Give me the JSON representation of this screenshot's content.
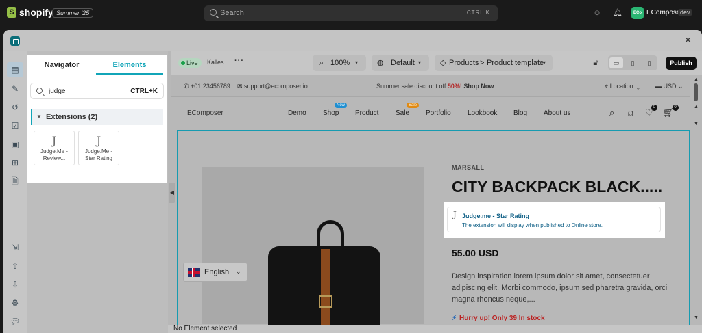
{
  "shopify": {
    "logo": "shopify",
    "edition": "Summer '25",
    "search_placeholder": "Search",
    "search_shortcut": "CTRL  K",
    "store_initials": "ECo",
    "store_name": "EComposer",
    "store_tag": "dev"
  },
  "panel": {
    "tabs": [
      "Navigator",
      "Elements"
    ],
    "active_tab": "Elements",
    "search_value": "judge",
    "search_shortcut": "CTRL+K",
    "group_label": "Extensions (2)",
    "cards": [
      {
        "glyph": "J",
        "name": "Judge.Me - Review..."
      },
      {
        "glyph": "J",
        "name": "Judge.Me - Star Rating"
      }
    ]
  },
  "toolbar": {
    "live_label": "Live",
    "theme_name": "Kalles",
    "zoom": "100%",
    "preset": "Default",
    "crumb_root": "Products",
    "crumb_sep": ">",
    "crumb_page": "Product template",
    "publish_label": "Publish"
  },
  "announce": {
    "phone": "+01 23456789",
    "email": "support@ecomposer.io",
    "promo_prefix": "Summer sale discount off ",
    "promo_percent": "50%!",
    "promo_link": " Shop Now",
    "location": "Location",
    "currency": "USD"
  },
  "storenav": {
    "brand": "EComposer",
    "links": [
      "Demo",
      "Shop",
      "Product",
      "Sale",
      "Portfolio",
      "Lookbook",
      "Blog",
      "About us"
    ],
    "shop_badge": "New",
    "sale_badge": "Sale",
    "wishlist_count": "0",
    "cart_count": "0"
  },
  "product": {
    "vendor": "MARSALL",
    "title": "CITY BACKPACK BLACK.....",
    "ext_glyph": "J",
    "ext_title": "Judge.me - Star Rating",
    "ext_desc": "The extension will display when published to Online store.",
    "price": "55.00 USD",
    "desc_lines": [
      "Design inspiration lorem ipsum dolor sit amet, consectetuer",
      "adipiscing elit. Morbi commodo, ipsum sed pharetra gravida, orci",
      "magna rhoncus neque,..."
    ],
    "stock": "Hurry up! Only 39 In stock",
    "language": "English"
  },
  "status": "No Element selected",
  "colors": {
    "accent": "#11a5b8",
    "live_dot": "#1aa04a",
    "badge_new": "#1f8fd1",
    "badge_sale": "#e08a13",
    "stock_red": "#b22222"
  }
}
